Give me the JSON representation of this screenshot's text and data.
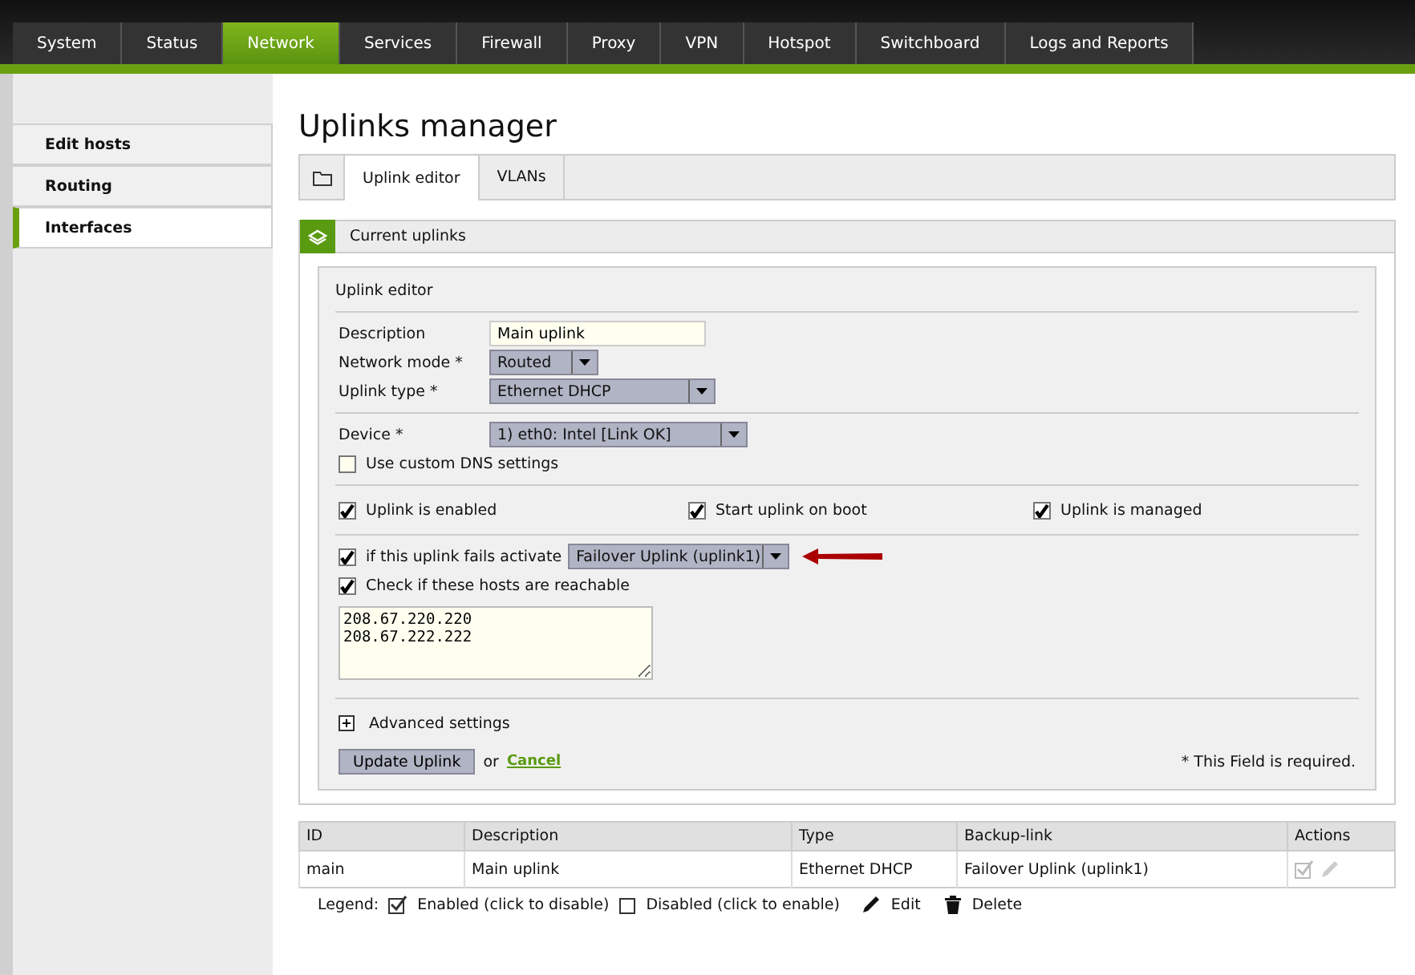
{
  "nav": [
    {
      "label": "System",
      "selected": false
    },
    {
      "label": "Status",
      "selected": false
    },
    {
      "label": "Network",
      "selected": true
    },
    {
      "label": "Services",
      "selected": false
    },
    {
      "label": "Firewall",
      "selected": false
    },
    {
      "label": "Proxy",
      "selected": false
    },
    {
      "label": "VPN",
      "selected": false
    },
    {
      "label": "Hotspot",
      "selected": false
    },
    {
      "label": "Switchboard",
      "selected": false
    },
    {
      "label": "Logs and Reports",
      "selected": false
    }
  ],
  "sidebar": {
    "items": [
      {
        "label": "Edit hosts",
        "selected": false
      },
      {
        "label": "Routing",
        "selected": false
      },
      {
        "label": "Interfaces",
        "selected": true
      }
    ]
  },
  "title": "Uplinks manager",
  "tabs": [
    {
      "label": "Uplink editor",
      "selected": true
    },
    {
      "label": "VLANs",
      "selected": false
    }
  ],
  "panel": {
    "title": "Current uplinks"
  },
  "editor": {
    "title": "Uplink editor",
    "description": {
      "label": "Description",
      "value": "Main uplink"
    },
    "network_mode": {
      "label": "Network mode *",
      "value": "Routed"
    },
    "uplink_type": {
      "label": "Uplink type *",
      "value": "Ethernet DHCP"
    },
    "device": {
      "label": "Device *",
      "value": "1) eth0: Intel [Link OK]"
    },
    "custom_dns": {
      "label": "Use custom DNS settings",
      "checked": false
    },
    "flags": [
      {
        "label": "Uplink is enabled",
        "checked": true
      },
      {
        "label": "Start uplink on boot",
        "checked": true
      },
      {
        "label": "Uplink is managed",
        "checked": true
      }
    ],
    "failover": {
      "label": "if this uplink fails activate",
      "checked": true,
      "value": "Failover Uplink (uplink1)"
    },
    "check_hosts": {
      "label": "Check if these hosts are reachable",
      "checked": true,
      "value": "208.67.220.220\n208.67.222.222"
    },
    "advanced": {
      "label": "Advanced settings",
      "expanded": false
    },
    "submit": "Update Uplink",
    "or": "or",
    "cancel": "Cancel",
    "required_note": "* This Field is required."
  },
  "table": {
    "columns": [
      "ID",
      "Description",
      "Type",
      "Backup-link",
      "Actions"
    ],
    "rows": [
      {
        "cells": [
          "main",
          "Main uplink",
          "Ethernet DHCP",
          "Failover Uplink (uplink1)"
        ],
        "enabled": true
      }
    ]
  },
  "legend": {
    "label": "Legend:",
    "enabled": "Enabled (click to disable)",
    "disabled": "Disabled (click to enable)",
    "edit": "Edit",
    "delete": "Delete"
  }
}
